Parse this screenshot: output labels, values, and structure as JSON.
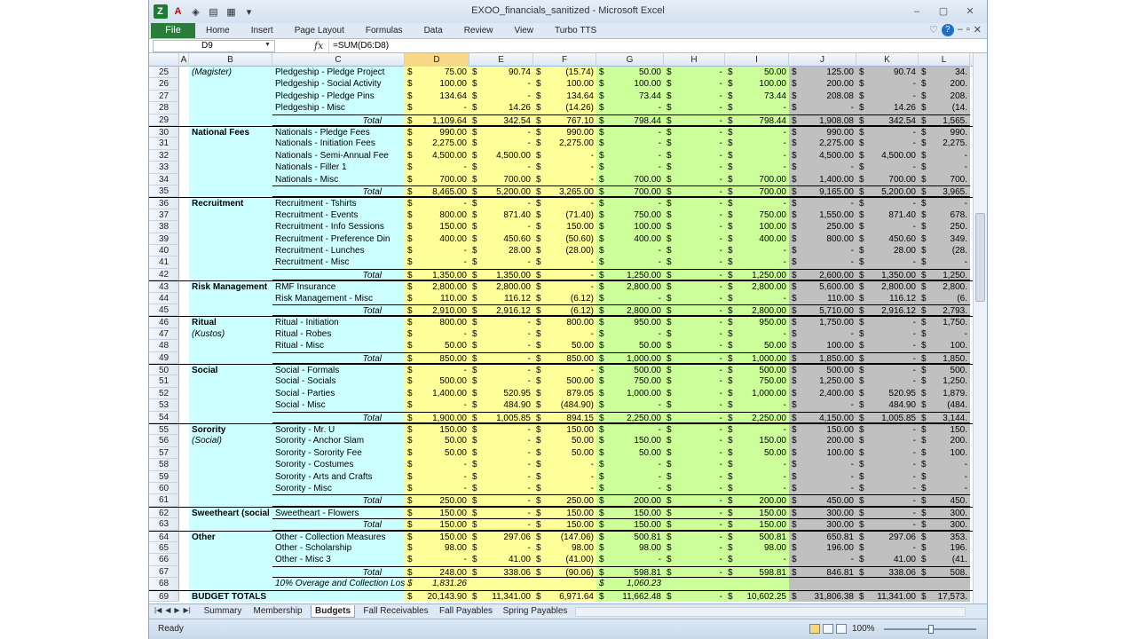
{
  "window": {
    "title": "EXOO_financials_sanitized - Microsoft Excel",
    "controls": [
      "–",
      "▢",
      "✕"
    ]
  },
  "ribbon": {
    "file_label": "File",
    "tabs": [
      "Home",
      "Insert",
      "Page Layout",
      "Formulas",
      "Data",
      "Review",
      "View",
      "Turbo TTS"
    ]
  },
  "formula_bar": {
    "name_box": "D9",
    "fx": "fx",
    "formula": "=SUM(D6:D8)"
  },
  "columns": [
    "A",
    "B",
    "C",
    "D",
    "E",
    "F",
    "G",
    "H",
    "I",
    "J",
    "K",
    "L"
  ],
  "selected_column": "D",
  "rows": [
    {
      "n": "25",
      "b": "(Magister)",
      "bi": true,
      "c": "Pledgeship - Pledge Project",
      "d": "75.00",
      "e": "90.74",
      "f": "(15.74)",
      "g": "50.00",
      "h": "-",
      "i": "50.00",
      "j": "125.00",
      "k": "90.74",
      "l": "34."
    },
    {
      "n": "26",
      "b": "",
      "c": "Pledgeship - Social Activity",
      "d": "100.00",
      "e": "-",
      "f": "100.00",
      "g": "100.00",
      "h": "-",
      "i": "100.00",
      "j": "200.00",
      "k": "-",
      "l": "200."
    },
    {
      "n": "27",
      "b": "",
      "c": "Pledgeship - Pledge Pins",
      "d": "134.64",
      "e": "-",
      "f": "134.64",
      "g": "73.44",
      "h": "-",
      "i": "73.44",
      "j": "208.08",
      "k": "-",
      "l": "208."
    },
    {
      "n": "28",
      "b": "",
      "c": "Pledgeship - Misc",
      "d": "-",
      "e": "14.26",
      "f": "(14.26)",
      "g": "-",
      "h": "-",
      "i": "-",
      "j": "-",
      "k": "14.26",
      "l": "(14."
    },
    {
      "n": "29",
      "b": "",
      "c": "Total",
      "total": true,
      "d": "1,109.64",
      "e": "342.54",
      "f": "767.10",
      "g": "798.44",
      "h": "-",
      "i": "798.44",
      "j": "1,908.08",
      "k": "342.54",
      "l": "1,565."
    },
    {
      "n": "30",
      "b": "National Fees",
      "grp": true,
      "c": "Nationals - Pledge Fees",
      "d": "990.00",
      "e": "-",
      "f": "990.00",
      "g": "-",
      "h": "-",
      "i": "-",
      "j": "990.00",
      "k": "-",
      "l": "990."
    },
    {
      "n": "31",
      "b": "",
      "c": "Nationals - Initiation Fees",
      "d": "2,275.00",
      "e": "-",
      "f": "2,275.00",
      "g": "-",
      "h": "-",
      "i": "-",
      "j": "2,275.00",
      "k": "-",
      "l": "2,275."
    },
    {
      "n": "32",
      "b": "",
      "c": "Nationals - Semi-Annual Fee",
      "d": "4,500.00",
      "e": "4,500.00",
      "f": "-",
      "g": "-",
      "h": "-",
      "i": "-",
      "j": "4,500.00",
      "k": "4,500.00",
      "l": "-"
    },
    {
      "n": "33",
      "b": "",
      "c": "Nationals - Filler 1",
      "d": "-",
      "e": "-",
      "f": "-",
      "g": "-",
      "h": "-",
      "i": "-",
      "j": "-",
      "k": "-",
      "l": "-"
    },
    {
      "n": "34",
      "b": "",
      "c": "Nationals - Misc",
      "d": "700.00",
      "e": "700.00",
      "f": "-",
      "g": "700.00",
      "h": "-",
      "i": "700.00",
      "j": "1,400.00",
      "k": "700.00",
      "l": "700."
    },
    {
      "n": "35",
      "b": "",
      "c": "Total",
      "total": true,
      "d": "8,465.00",
      "e": "5,200.00",
      "f": "3,265.00",
      "g": "700.00",
      "h": "-",
      "i": "700.00",
      "j": "9,165.00",
      "k": "5,200.00",
      "l": "3,965."
    },
    {
      "n": "36",
      "b": "Recruitment",
      "grp": true,
      "c": "Recruitment - Tshirts",
      "d": "-",
      "e": "-",
      "f": "-",
      "g": "-",
      "h": "-",
      "i": "-",
      "j": "-",
      "k": "-",
      "l": "-"
    },
    {
      "n": "37",
      "b": "",
      "c": "Recruitment - Events",
      "d": "800.00",
      "e": "871.40",
      "f": "(71.40)",
      "g": "750.00",
      "h": "-",
      "i": "750.00",
      "j": "1,550.00",
      "k": "871.40",
      "l": "678."
    },
    {
      "n": "38",
      "b": "",
      "c": "Recruitment - Info Sessions",
      "d": "150.00",
      "e": "-",
      "f": "150.00",
      "g": "100.00",
      "h": "-",
      "i": "100.00",
      "j": "250.00",
      "k": "-",
      "l": "250."
    },
    {
      "n": "39",
      "b": "",
      "c": "Recruitment - Preference Din",
      "d": "400.00",
      "e": "450.60",
      "f": "(50.60)",
      "g": "400.00",
      "h": "-",
      "i": "400.00",
      "j": "800.00",
      "k": "450.60",
      "l": "349."
    },
    {
      "n": "40",
      "b": "",
      "c": "Recruitment - Lunches",
      "d": "-",
      "e": "28.00",
      "f": "(28.00)",
      "g": "-",
      "h": "-",
      "i": "-",
      "j": "-",
      "k": "28.00",
      "l": "(28."
    },
    {
      "n": "41",
      "b": "",
      "c": "Recruitment - Misc",
      "d": "-",
      "e": "-",
      "f": "-",
      "g": "-",
      "h": "-",
      "i": "-",
      "j": "-",
      "k": "-",
      "l": "-"
    },
    {
      "n": "42",
      "b": "",
      "c": "Total",
      "total": true,
      "d": "1,350.00",
      "e": "1,350.00",
      "f": "-",
      "g": "1,250.00",
      "h": "-",
      "i": "1,250.00",
      "j": "2,600.00",
      "k": "1,350.00",
      "l": "1,250."
    },
    {
      "n": "43",
      "b": "Risk Management",
      "grp": true,
      "c": "RMF Insurance",
      "d": "2,800.00",
      "e": "2,800.00",
      "f": "-",
      "g": "2,800.00",
      "h": "-",
      "i": "2,800.00",
      "j": "5,600.00",
      "k": "2,800.00",
      "l": "2,800."
    },
    {
      "n": "44",
      "b": "",
      "c": "Risk Management - Misc",
      "d": "110.00",
      "e": "116.12",
      "f": "(6.12)",
      "g": "-",
      "h": "-",
      "i": "-",
      "j": "110.00",
      "k": "116.12",
      "l": "(6."
    },
    {
      "n": "45",
      "b": "",
      "c": "Total",
      "total": true,
      "d": "2,910.00",
      "e": "2,916.12",
      "f": "(6.12)",
      "g": "2,800.00",
      "h": "-",
      "i": "2,800.00",
      "j": "5,710.00",
      "k": "2,916.12",
      "l": "2,793."
    },
    {
      "n": "46",
      "b": "Ritual",
      "grp": true,
      "c": "Ritual - Initiation",
      "d": "800.00",
      "e": "-",
      "f": "800.00",
      "g": "950.00",
      "h": "-",
      "i": "950.00",
      "j": "1,750.00",
      "k": "-",
      "l": "1,750."
    },
    {
      "n": "47",
      "b": "(Kustos)",
      "bi": true,
      "c": "Ritual - Robes",
      "d": "-",
      "e": "-",
      "f": "-",
      "g": "-",
      "h": "-",
      "i": "-",
      "j": "-",
      "k": "-",
      "l": "-"
    },
    {
      "n": "48",
      "b": "",
      "c": "Ritual - Misc",
      "d": "50.00",
      "e": "-",
      "f": "50.00",
      "g": "50.00",
      "h": "-",
      "i": "50.00",
      "j": "100.00",
      "k": "-",
      "l": "100."
    },
    {
      "n": "49",
      "b": "",
      "c": "Total",
      "total": true,
      "d": "850.00",
      "e": "-",
      "f": "850.00",
      "g": "1,000.00",
      "h": "-",
      "i": "1,000.00",
      "j": "1,850.00",
      "k": "-",
      "l": "1,850."
    },
    {
      "n": "50",
      "b": "Social",
      "grp": true,
      "c": "Social - Formals",
      "d": "-",
      "e": "-",
      "f": "-",
      "g": "500.00",
      "h": "-",
      "i": "500.00",
      "j": "500.00",
      "k": "-",
      "l": "500."
    },
    {
      "n": "51",
      "b": "",
      "c": "Social - Socials",
      "d": "500.00",
      "e": "-",
      "f": "500.00",
      "g": "750.00",
      "h": "-",
      "i": "750.00",
      "j": "1,250.00",
      "k": "-",
      "l": "1,250."
    },
    {
      "n": "52",
      "b": "",
      "c": "Social - Parties",
      "d": "1,400.00",
      "e": "520.95",
      "f": "879.05",
      "g": "1,000.00",
      "h": "-",
      "i": "1,000.00",
      "j": "2,400.00",
      "k": "520.95",
      "l": "1,879."
    },
    {
      "n": "53",
      "b": "",
      "c": "Social - Misc",
      "d": "-",
      "e": "484.90",
      "f": "(484.90)",
      "g": "-",
      "h": "-",
      "i": "-",
      "j": "-",
      "k": "484.90",
      "l": "(484."
    },
    {
      "n": "54",
      "b": "",
      "c": "Total",
      "total": true,
      "d": "1,900.00",
      "e": "1,005.85",
      "f": "894.15",
      "g": "2,250.00",
      "h": "-",
      "i": "2,250.00",
      "j": "4,150.00",
      "k": "1,005.85",
      "l": "3,144."
    },
    {
      "n": "55",
      "b": "Sorority",
      "grp": true,
      "c": "Sorority - Mr. U",
      "d": "150.00",
      "e": "-",
      "f": "150.00",
      "g": "-",
      "h": "-",
      "i": "-",
      "j": "150.00",
      "k": "-",
      "l": "150."
    },
    {
      "n": "56",
      "b": "(Social)",
      "bi": true,
      "c": "Sorority - Anchor Slam",
      "d": "50.00",
      "e": "-",
      "f": "50.00",
      "g": "150.00",
      "h": "-",
      "i": "150.00",
      "j": "200.00",
      "k": "-",
      "l": "200."
    },
    {
      "n": "57",
      "b": "",
      "c": "Sorority - Sorority Fee",
      "d": "50.00",
      "e": "-",
      "f": "50.00",
      "g": "50.00",
      "h": "-",
      "i": "50.00",
      "j": "100.00",
      "k": "-",
      "l": "100."
    },
    {
      "n": "58",
      "b": "",
      "c": "Sorority - Costumes",
      "d": "-",
      "e": "-",
      "f": "-",
      "g": "-",
      "h": "-",
      "i": "-",
      "j": "-",
      "k": "-",
      "l": "-"
    },
    {
      "n": "59",
      "b": "",
      "c": "Sorority - Arts and Crafts",
      "d": "-",
      "e": "-",
      "f": "-",
      "g": "-",
      "h": "-",
      "i": "-",
      "j": "-",
      "k": "-",
      "l": "-"
    },
    {
      "n": "60",
      "b": "",
      "c": "Sorority - Misc",
      "d": "-",
      "e": "-",
      "f": "-",
      "g": "-",
      "h": "-",
      "i": "-",
      "j": "-",
      "k": "-",
      "l": "-"
    },
    {
      "n": "61",
      "b": "",
      "c": "Total",
      "total": true,
      "d": "250.00",
      "e": "-",
      "f": "250.00",
      "g": "200.00",
      "h": "-",
      "i": "200.00",
      "j": "450.00",
      "k": "-",
      "l": "450."
    },
    {
      "n": "62",
      "b": "Sweetheart (social",
      "grp": true,
      "c": "Sweetheart - Flowers",
      "d": "150.00",
      "e": "-",
      "f": "150.00",
      "g": "150.00",
      "h": "-",
      "i": "150.00",
      "j": "300.00",
      "k": "-",
      "l": "300."
    },
    {
      "n": "63",
      "b": "",
      "c": "Total",
      "total": true,
      "d": "150.00",
      "e": "-",
      "f": "150.00",
      "g": "150.00",
      "h": "-",
      "i": "150.00",
      "j": "300.00",
      "k": "-",
      "l": "300."
    },
    {
      "n": "64",
      "b": "Other",
      "grp": true,
      "c": "Other - Collection Measures",
      "d": "150.00",
      "e": "297.06",
      "f": "(147.06)",
      "g": "500.81",
      "h": "-",
      "i": "500.81",
      "j": "650.81",
      "k": "297.06",
      "l": "353."
    },
    {
      "n": "65",
      "b": "",
      "c": "Other - Scholarship",
      "d": "98.00",
      "e": "-",
      "f": "98.00",
      "g": "98.00",
      "h": "-",
      "i": "98.00",
      "j": "196.00",
      "k": "-",
      "l": "196."
    },
    {
      "n": "66",
      "b": "",
      "c": "Other - Misc 3",
      "d": "-",
      "e": "41.00",
      "f": "(41.00)",
      "g": "-",
      "h": "-",
      "i": "-",
      "j": "-",
      "k": "41.00",
      "l": "(41."
    },
    {
      "n": "67",
      "b": "",
      "c": "Total",
      "total": true,
      "d": "248.00",
      "e": "338.06",
      "f": "(90.06)",
      "g": "598.81",
      "h": "-",
      "i": "598.81",
      "j": "846.81",
      "k": "338.06",
      "l": "508."
    },
    {
      "n": "68",
      "b": "",
      "c": "10% Overage and Collection Loss",
      "overage": true,
      "d": "1,831.26",
      "e": "",
      "f": "",
      "g": "1,060.23",
      "h": "",
      "i": "",
      "j": "",
      "k": "",
      "l": ""
    },
    {
      "n": "69",
      "b": "BUDGET TOTALS",
      "grp": true,
      "c": "",
      "d": "20,143.90",
      "e": "11,341.00",
      "f": "6,971.64",
      "g": "11,662.48",
      "h": "-",
      "i": "10,602.25",
      "j": "31,806.38",
      "k": "11,341.00",
      "l": "17,573."
    }
  ],
  "sheets": [
    "Summary",
    "Membership",
    "Budgets",
    "Fall Receivables",
    "Fall Payables",
    "Spring Payables"
  ],
  "active_sheet": "Budgets",
  "status": {
    "ready": "Ready",
    "zoom": "100%"
  },
  "currency_symbol": "$"
}
